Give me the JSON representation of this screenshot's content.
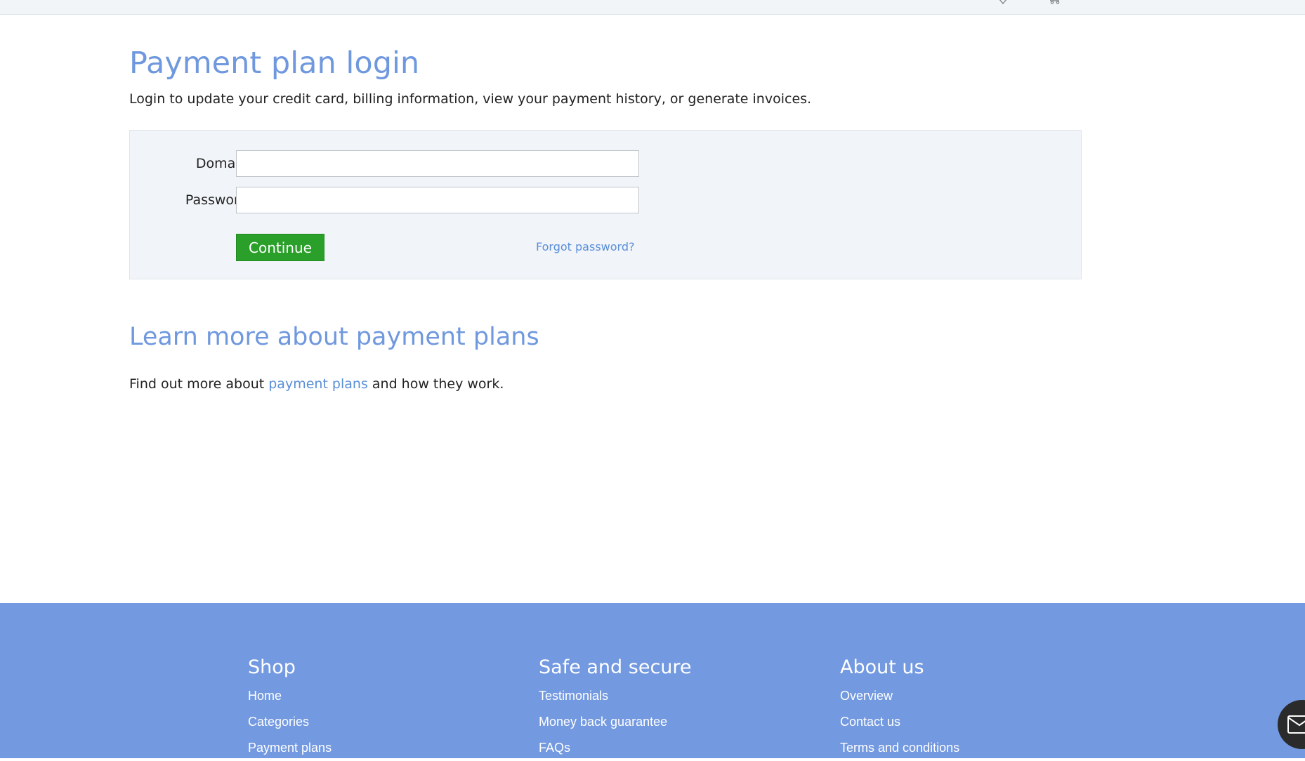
{
  "main": {
    "title": "Payment plan login",
    "intro": "Login to update your credit card, billing information, view your payment history, or generate invoices."
  },
  "login_form": {
    "domain_label": "Domain:",
    "domain_value": "",
    "password_label": "Password:",
    "password_value": "",
    "continue_label": "Continue",
    "forgot_label": "Forgot password?"
  },
  "learn_more": {
    "title": "Learn more about payment plans",
    "text_before": "Find out more about ",
    "link_label": "payment plans",
    "text_after": " and how they work."
  },
  "footer": {
    "columns": [
      {
        "heading": "Shop",
        "links": [
          "Home",
          "Categories",
          "Payment plans"
        ]
      },
      {
        "heading": "Safe and secure",
        "links": [
          "Testimonials",
          "Money back guarantee",
          "FAQs"
        ]
      },
      {
        "heading": "About us",
        "links": [
          "Overview",
          "Contact us",
          "Terms and conditions"
        ]
      }
    ]
  },
  "icons": {
    "chat_button": "envelope-icon",
    "topbar_icons": [
      "heart-icon",
      "cart-icon"
    ]
  },
  "colors": {
    "heading": "#6f98de",
    "link": "#5a8fd8",
    "button": "#2aa02a",
    "footer_bg": "#7399e0",
    "form_bg": "#f1f4f8"
  }
}
